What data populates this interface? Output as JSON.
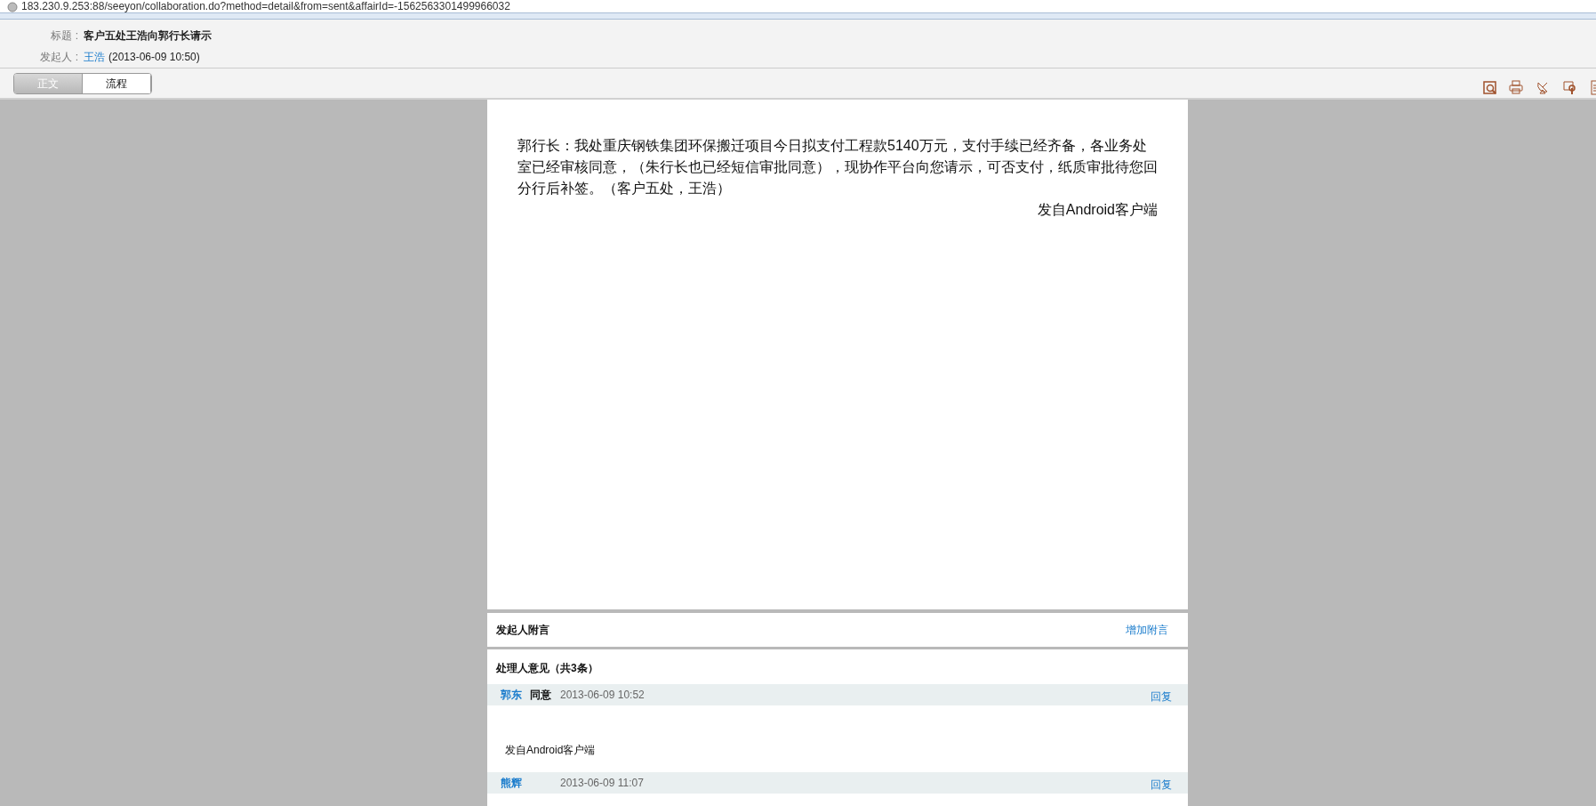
{
  "address_bar": {
    "url": "183.230.9.253:88/seeyon/collaboration.do?method=detail&from=sent&affairId=-1562563301499966032"
  },
  "header": {
    "title_label": "标题 :",
    "title": "客户五处王浩向郭行长请示",
    "sender_label": "发起人 :",
    "sender": "王浩",
    "sent_time": "(2013-06-09 10:50)"
  },
  "tabs": [
    {
      "label": "正文",
      "selected": true
    },
    {
      "label": "流程",
      "selected": false
    }
  ],
  "body": {
    "text": "郭行长：我处重庆钢铁集团环保搬迁项目今日拟支付工程款5140万元，支付手续已经齐备，各业务处室已经审核同意，（朱行长也已经短信审批同意），现协作平台向您请示，可否支付，纸质审批待您回分行后补签。（客户五处，王浩）",
    "signature": "发自Android客户端"
  },
  "sender_note": {
    "heading": "发起人附言",
    "action": "增加附言"
  },
  "opinions": {
    "heading": "处理人意见（共3条）",
    "items": [
      {
        "name": "郭东",
        "attitude": "同意",
        "time": "2013-06-09 10:52",
        "reply": "回复",
        "text": "发自Android客户端"
      },
      {
        "name": "熊辉",
        "time": "2013-06-09 11:07",
        "reply": "回复"
      }
    ]
  }
}
